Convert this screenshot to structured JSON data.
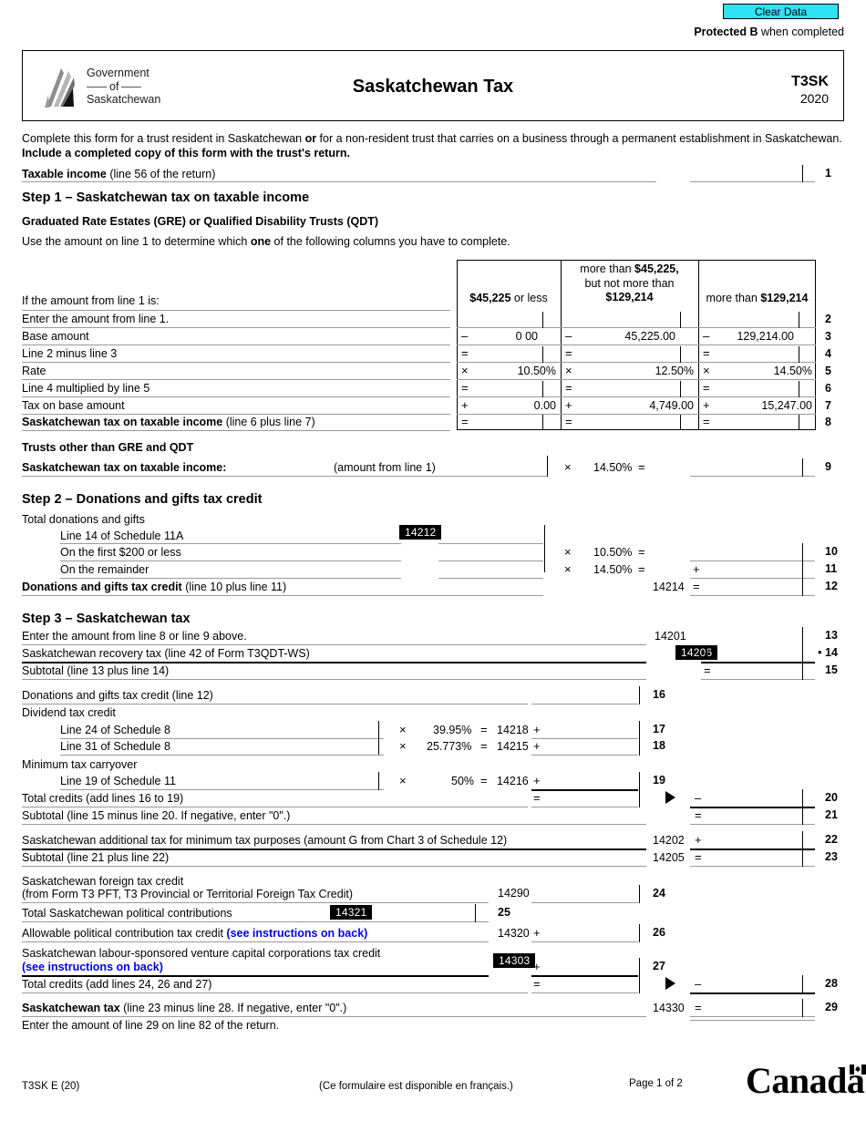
{
  "toolbar": {
    "clear_data": "Clear Data"
  },
  "header": {
    "protected_bold": "Protected B",
    "protected_rest": " when completed",
    "logo_line1": "Government",
    "logo_line2": "of",
    "logo_line3": "Saskatchewan",
    "title": "Saskatchewan Tax",
    "form_code": "T3SK",
    "form_year": "2020"
  },
  "intro": {
    "p1a": "Complete this form for a trust resident in Saskatchewan ",
    "p1b": "or",
    "p1c": " for a non-resident trust that carries on a business through a permanent establishment in Saskatchewan.",
    "p2": "Include a completed copy of this form with the trust's return."
  },
  "taxable_income": {
    "label_bold": "Taxable income",
    "label_rest": " (line 56 of the return)",
    "line_no": "1"
  },
  "step1": {
    "heading": "Step 1 – Saskatchewan tax on taxable income",
    "subheading": "Graduated Rate Estates (GRE) or Qualified Disability Trusts (QDT)",
    "instruction_a": "Use the amount on line 1 to determine which ",
    "instruction_b": "one",
    "instruction_c": " of the following columns you have to complete.",
    "row_label": "If the amount from line 1 is:",
    "columns": [
      {
        "l1_bold": "$45,225",
        "l1_rest": " or less",
        "l2": "",
        "l3_bold": "",
        "l3_rest": ""
      },
      {
        "l1_rest": "more than ",
        "l1_bold": "$45,225,",
        "l2": "but not more than",
        "l3_bold": "$129,214",
        "l3_rest": ""
      },
      {
        "l1_rest": "more than ",
        "l1_bold": "$129,214",
        "l2": "",
        "l3_bold": "",
        "l3_rest": ""
      }
    ],
    "rows": [
      {
        "no": "2",
        "label": "Enter the amount from line 1.",
        "cells": [
          "",
          "",
          ""
        ],
        "ops": [
          "",
          "",
          ""
        ]
      },
      {
        "no": "3",
        "label": "Base amount",
        "cells": [
          "0 00",
          "45,225.00",
          "129,214.00"
        ],
        "ops": [
          "–",
          "–",
          "–"
        ]
      },
      {
        "no": "4",
        "label": "Line 2 minus line 3",
        "cells": [
          "",
          "",
          ""
        ],
        "ops": [
          "=",
          "=",
          "="
        ]
      },
      {
        "no": "5",
        "label": "Rate",
        "cells": [
          "10.50%",
          "12.50%",
          "14.50%"
        ],
        "ops": [
          "×",
          "×",
          "×"
        ]
      },
      {
        "no": "6",
        "label": "Line 4 multiplied by line 5",
        "cells": [
          "",
          "",
          ""
        ],
        "ops": [
          "=",
          "=",
          "="
        ]
      },
      {
        "no": "7",
        "label": "Tax on base amount",
        "cells": [
          "0.00",
          "4,749.00",
          "15,247.00"
        ],
        "ops": [
          "+",
          "+",
          "+"
        ]
      },
      {
        "no": "8",
        "label_bold": "Saskatchewan tax on taxable income",
        "label_rest": " (line 6 plus line 7)",
        "cells": [
          "",
          "",
          ""
        ],
        "ops": [
          "=",
          "=",
          "="
        ]
      }
    ],
    "other_trusts_heading": "Trusts other than GRE and QDT",
    "line9_label": "Saskatchewan tax on taxable income:",
    "line9_note": "(amount from line 1)",
    "line9_op": "×",
    "line9_rate": "14.50%",
    "line9_eq": "=",
    "line9_no": "9"
  },
  "step2": {
    "heading": "Step 2 – Donations and gifts tax credit",
    "total_label": "Total donations and gifts",
    "sched_label": "Line 14 of Schedule 11A",
    "sched_code": "14212",
    "rows": [
      {
        "no": "10",
        "label": "On the first $200 or less",
        "op": "×",
        "rate": "10.50%",
        "eq": "=",
        "carry": ""
      },
      {
        "no": "11",
        "label": "On the remainder",
        "op": "×",
        "rate": "14.50%",
        "eq": "=",
        "carry": "+"
      }
    ],
    "total_credit_bold": "Donations and gifts tax credit",
    "total_credit_rest": " (line 10 plus line 11)",
    "total_credit_code": "14214",
    "total_credit_op": "=",
    "total_credit_no": "12"
  },
  "step3": {
    "heading": "Step 3 – Saskatchewan tax",
    "line13": {
      "label": "Enter the amount from line 8 or line 9 above.",
      "code": "14201",
      "no": "13"
    },
    "line14": {
      "label": "Saskatchewan recovery tax (line 42 of Form T3QDT-WS)",
      "code": "14206",
      "op": "+",
      "no": "14",
      "bullet": "•"
    },
    "line15": {
      "label": "Subtotal (line 13 plus line 14)",
      "op": "=",
      "no": "15"
    },
    "line16": {
      "label": "Donations and gifts tax credit (line 12)",
      "no": "16"
    },
    "dividend_heading": "Dividend tax credit",
    "line17": {
      "label": "Line 24 of Schedule 8",
      "op": "×",
      "rate": "39.95%",
      "eq": "=",
      "code": "14218",
      "carry": "+",
      "no": "17"
    },
    "line18": {
      "label": "Line 31 of Schedule 8",
      "op": "×",
      "rate": "25.773%",
      "eq": "=",
      "code": "14215",
      "carry": "+",
      "no": "18"
    },
    "mintax_heading": "Minimum tax carryover",
    "line19": {
      "label": "Line 19 of Schedule 11",
      "op": "×",
      "rate": "50%",
      "eq": "=",
      "code": "14216",
      "carry": "+",
      "no": "19"
    },
    "line20": {
      "label": "Total credits (add lines 16 to 19)",
      "op": "=",
      "minus": "–",
      "no": "20"
    },
    "line21": {
      "label": "Subtotal (line 15 minus line 20. If negative, enter \"0\".)",
      "op": "=",
      "no": "21"
    },
    "line22": {
      "label": "Saskatchewan additional tax for minimum tax purposes (amount G from Chart 3 of Schedule 12)",
      "code": "14202",
      "op": "+",
      "no": "22"
    },
    "line23": {
      "label": "Subtotal (line 21 plus line 22)",
      "code": "14205",
      "op": "=",
      "no": "23"
    },
    "line24": {
      "label_l1": "Saskatchewan foreign tax credit",
      "label_l2": "(from Form T3 PFT, T3 Provincial or Territorial Foreign Tax Credit)",
      "code": "14290",
      "no": "24"
    },
    "line25": {
      "label": "Total Saskatchewan political contributions",
      "code": "14321",
      "no": "25"
    },
    "line26": {
      "label": "Allowable political contribution tax credit ",
      "link": "(see instructions on back)",
      "code": "14320",
      "op": "+",
      "no": "26"
    },
    "line27": {
      "label_l1": "Saskatchewan labour-sponsored venture capital corporations tax credit",
      "link": "(see instructions on back)",
      "code": "14303",
      "op": "+",
      "no": "27"
    },
    "line28": {
      "label": "Total credits (add lines 24, 26 and 27)",
      "op": "=",
      "minus": "–",
      "no": "28"
    },
    "line29": {
      "label_bold": "Saskatchewan tax",
      "label_rest": " (line 23 minus line 28. If negative, enter \"0\".)",
      "code": "14330",
      "op": "=",
      "no": "29"
    },
    "closing": "Enter the amount of line 29 on line 82 of the return."
  },
  "footer": {
    "form_id": "T3SK E (20)",
    "french_note": "(Ce formulaire est disponible en français.)",
    "page": "Page 1 of 2",
    "wordmark": "Canada"
  },
  "colors": {
    "accent": "#2fe3f5",
    "link": "#0000ee",
    "rule": "#9a9a9a"
  }
}
